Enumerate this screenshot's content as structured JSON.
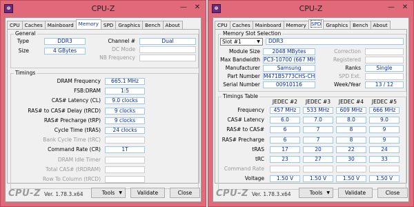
{
  "app": {
    "title": "CPU-Z",
    "icon_label": "⊗",
    "logo": "CPU-Z",
    "version": "Ver. 1.78.3.x64",
    "buttons": {
      "tools": "Tools",
      "validate": "Validate",
      "close": "Close"
    },
    "win_min": "—",
    "win_close": "✕",
    "accent_color": "#e06a7a"
  },
  "tabs": [
    "CPU",
    "Caches",
    "Mainboard",
    "Memory",
    "SPD",
    "Graphics",
    "Bench",
    "About"
  ],
  "memory": {
    "active_tab": "Memory",
    "general": {
      "title": "General",
      "type_label": "Type",
      "type_value": "DDR3",
      "size_label": "Size",
      "size_value": "4 GBytes",
      "channel_label": "Channel #",
      "channel_value": "Dual",
      "dc_mode_label": "DC Mode",
      "dc_mode_value": "",
      "nb_freq_label": "NB Frequency",
      "nb_freq_value": ""
    },
    "timings": {
      "title": "Timings",
      "rows": [
        {
          "label": "DRAM Frequency",
          "value": "665.1 MHz",
          "disabled": false
        },
        {
          "label": "FSB:DRAM",
          "value": "1:5",
          "disabled": false
        },
        {
          "label": "CAS# Latency (CL)",
          "value": "9.0 clocks",
          "disabled": false
        },
        {
          "label": "RAS# to CAS# Delay (tRCD)",
          "value": "9 clocks",
          "disabled": false
        },
        {
          "label": "RAS# Precharge (tRP)",
          "value": "9 clocks",
          "disabled": false
        },
        {
          "label": "Cycle Time (tRAS)",
          "value": "24 clocks",
          "disabled": false
        },
        {
          "label": "Bank Cycle Time (tRC)",
          "value": "",
          "disabled": true
        },
        {
          "label": "Command Rate (CR)",
          "value": "1T",
          "disabled": false
        },
        {
          "label": "DRAM Idle Timer",
          "value": "",
          "disabled": true
        },
        {
          "label": "Total CAS# (tRDRAM)",
          "value": "",
          "disabled": true
        },
        {
          "label": "Row To Column (tRCD)",
          "value": "",
          "disabled": true
        }
      ]
    }
  },
  "spd": {
    "active_tab": "SPD",
    "slot_group_title": "Memory Slot Selection",
    "slot_selected": "Slot #1",
    "slot_type": "DDR3",
    "module_size_label": "Module Size",
    "module_size_value": "2048 MBytes",
    "max_bw_label": "Max Bandwidth",
    "max_bw_value": "PC3-10700 (667 MHz)",
    "manufacturer_label": "Manufacturer",
    "manufacturer_value": "Samsung",
    "part_label": "Part Number",
    "part_value": "M471B5773CHS-CH9",
    "serial_label": "Serial Number",
    "serial_value": "00910116",
    "correction_label": "Correction",
    "correction_value": "",
    "registered_label": "Registered",
    "registered_value": "",
    "ranks_label": "Ranks",
    "ranks_value": "Single",
    "spd_ext_label": "SPD Ext.",
    "spd_ext_value": "",
    "week_year_label": "Week/Year",
    "week_year_value": "13 / 12",
    "table_title": "Timings Table",
    "columns": [
      "JEDEC #2",
      "JEDEC #3",
      "JEDEC #4",
      "JEDEC #5"
    ],
    "rows": [
      {
        "label": "Frequency",
        "disabled": false,
        "values": [
          "457 MHz",
          "533 MHz",
          "609 MHz",
          "666 MHz"
        ]
      },
      {
        "label": "CAS# Latency",
        "disabled": false,
        "values": [
          "6.0",
          "7.0",
          "8.0",
          "9.0"
        ]
      },
      {
        "label": "RAS# to CAS#",
        "disabled": false,
        "values": [
          "6",
          "7",
          "8",
          "9"
        ]
      },
      {
        "label": "RAS# Precharge",
        "disabled": false,
        "values": [
          "6",
          "7",
          "8",
          "9"
        ]
      },
      {
        "label": "tRAS",
        "disabled": false,
        "values": [
          "17",
          "20",
          "22",
          "24"
        ]
      },
      {
        "label": "tRC",
        "disabled": false,
        "values": [
          "23",
          "27",
          "30",
          "33"
        ]
      },
      {
        "label": "Command Rate",
        "disabled": true,
        "values": [
          "",
          "",
          "",
          ""
        ]
      },
      {
        "label": "Voltage",
        "disabled": false,
        "values": [
          "1.50 V",
          "1.50 V",
          "1.50 V",
          "1.50 V"
        ]
      }
    ]
  }
}
